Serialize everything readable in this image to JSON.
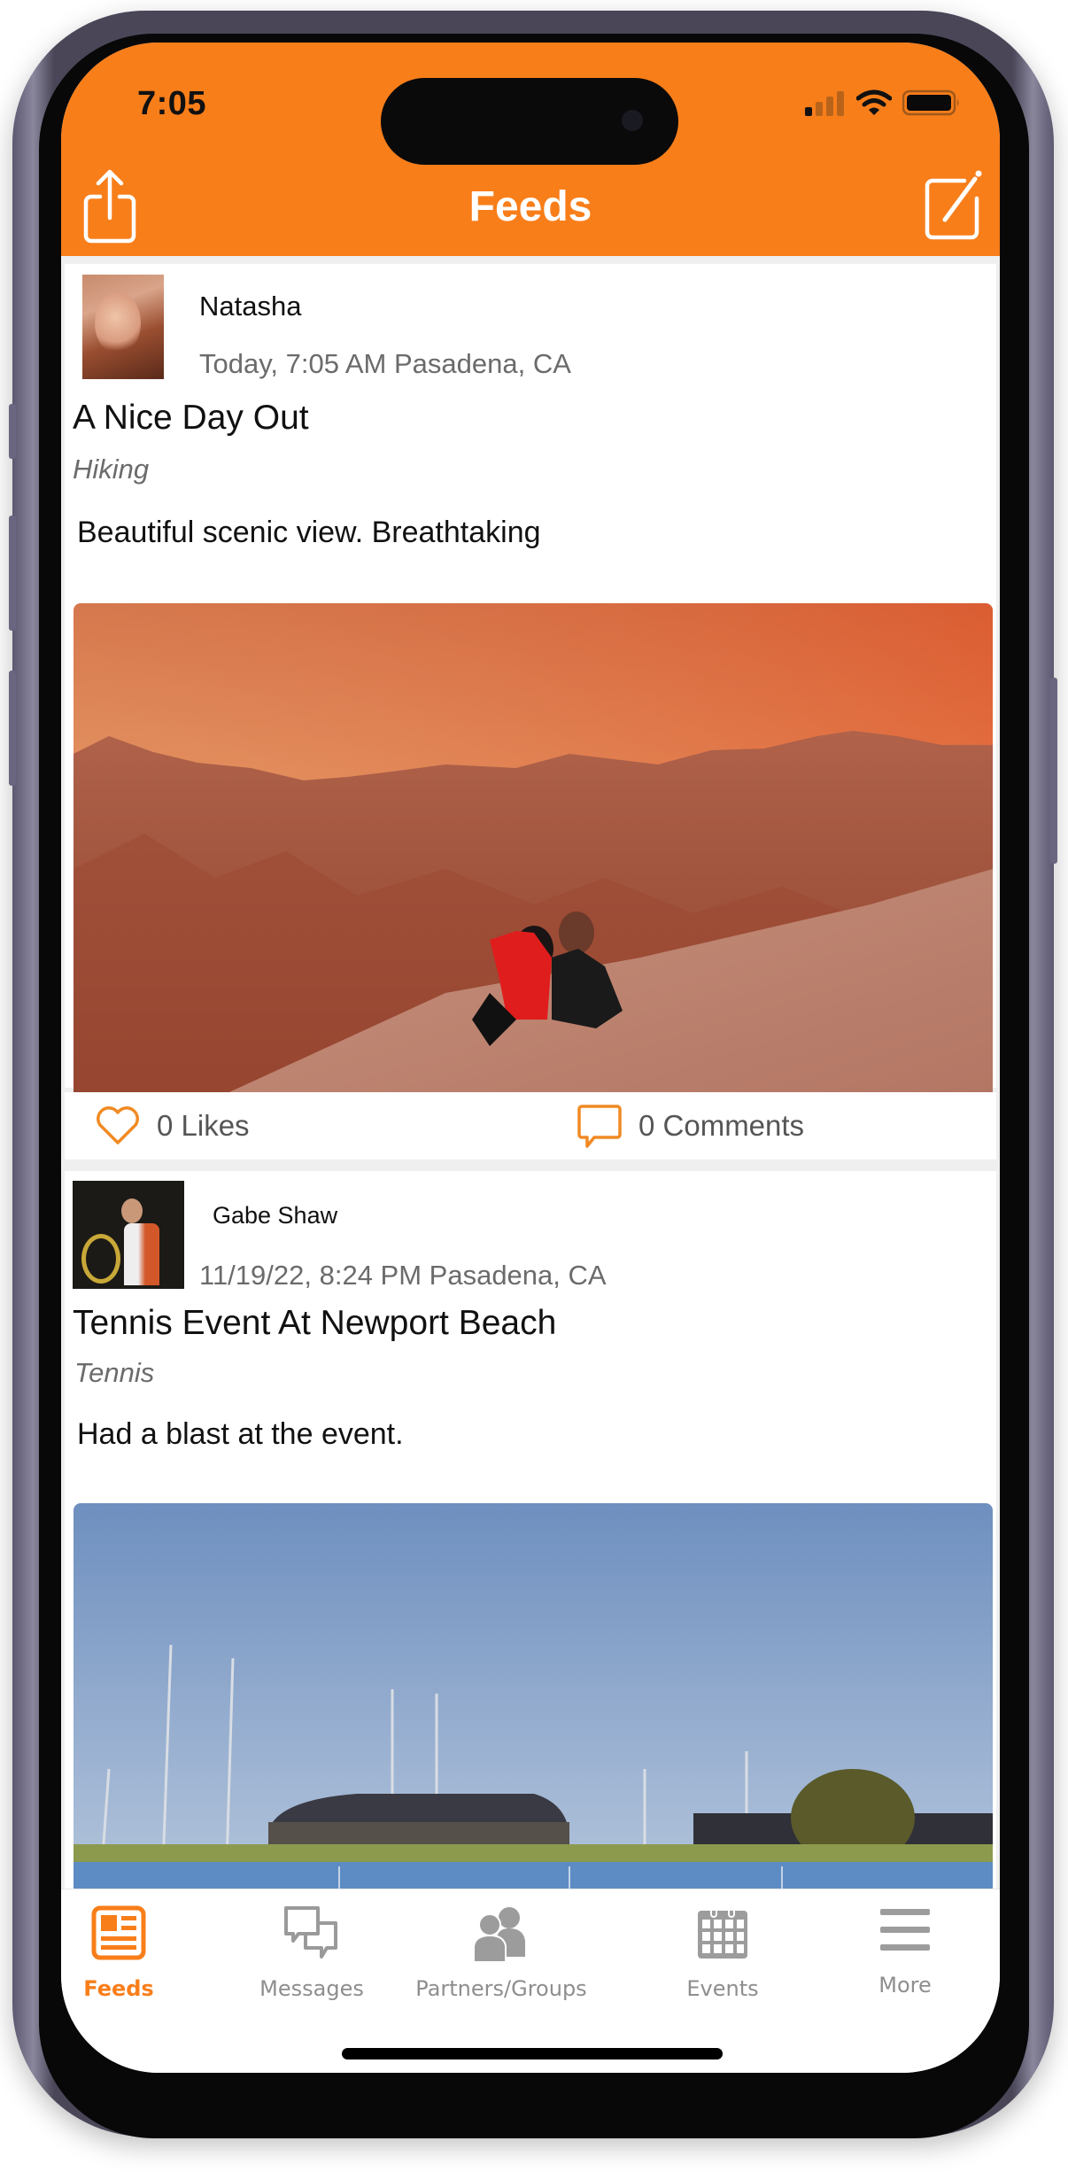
{
  "status_bar": {
    "time": "7:05",
    "signal_bars_active": 1,
    "signal_bars_total": 4,
    "wifi": "full",
    "battery_percent": 95
  },
  "header": {
    "title": "Feeds",
    "left_icon": "share-icon",
    "right_icon": "compose-icon",
    "accent_color": "#F87E1A"
  },
  "posts": [
    {
      "author": "Natasha",
      "meta": "Today, 7:05 AM Pasadena, CA",
      "title": "A Nice Day Out",
      "category": "Hiking",
      "body": "Beautiful scenic view. Breathtaking",
      "image": "desert-canyon-couple-photo",
      "likes": "0 Likes",
      "comments": "0 Comments"
    },
    {
      "author": "Gabe Shaw",
      "meta": "11/19/22, 8:24 PM Pasadena, CA",
      "title": "Tennis Event At Newport Beach",
      "category": "Tennis",
      "body": "Had a blast at the event.",
      "image": "tennis-courts-stadium-photo"
    }
  ],
  "tabbar": {
    "items": [
      {
        "label": "Feeds",
        "icon": "newspaper-icon",
        "active": true
      },
      {
        "label": "Messages",
        "icon": "chat-bubbles-icon",
        "active": false
      },
      {
        "label": "Partners/Groups",
        "icon": "people-icon",
        "active": false
      },
      {
        "label": "Events",
        "icon": "calendar-icon",
        "active": false
      },
      {
        "label": "More",
        "icon": "menu-icon",
        "active": false
      }
    ]
  }
}
